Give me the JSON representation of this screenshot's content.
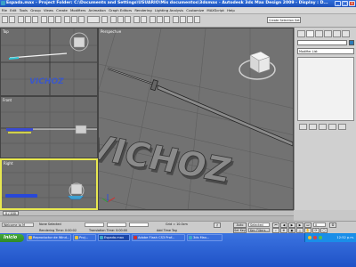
{
  "window": {
    "title": "Espada.max    - Project Folder: C:\\Documents and Settings\\USUARIO\\Mis documentos\\3dsmax    - Autodesk 3ds Max Design 2009    - Display : D..."
  },
  "menu": [
    "File",
    "Edit",
    "Tools",
    "Group",
    "Views",
    "Create",
    "Modifiers",
    "Animation",
    "Graph Editors",
    "Rendering",
    "Lighting Analysis",
    "Customize",
    "MAXScript",
    "Help"
  ],
  "toolbar": {
    "selection_set": "Create Selection Set"
  },
  "viewports": {
    "top": {
      "label": "Top"
    },
    "front": {
      "label": "Front"
    },
    "right": {
      "label": "Right"
    },
    "perspective": {
      "label": "Perspective"
    },
    "scene_text": "VICHOZ"
  },
  "command_panel": {
    "modifier_list": "Modifier List"
  },
  "timeline": {
    "frame": "0 / 100"
  },
  "status": {
    "selection": "None Selected",
    "grid": "Grid = 10.0cm",
    "maxscript": "Welcome to M",
    "rendering_time": "Rendering Time: 0:00:02",
    "translation_time": "Translation Time: 0:00:00",
    "add_time_tag": "Add Time Tag",
    "auto_key": "Auto Key",
    "set_key": "Set Key",
    "key_mode": "Selected",
    "key_filters": "Key Filters...",
    "current_frame": "0"
  },
  "taskbar": {
    "start": "Inicio",
    "tasks": [
      "Reproductor de Wind...",
      "Proj...",
      "Espada.max",
      "Adobe Flash CS3 Prof...",
      "3ds Max..."
    ],
    "clock": "12:52 p.m."
  }
}
